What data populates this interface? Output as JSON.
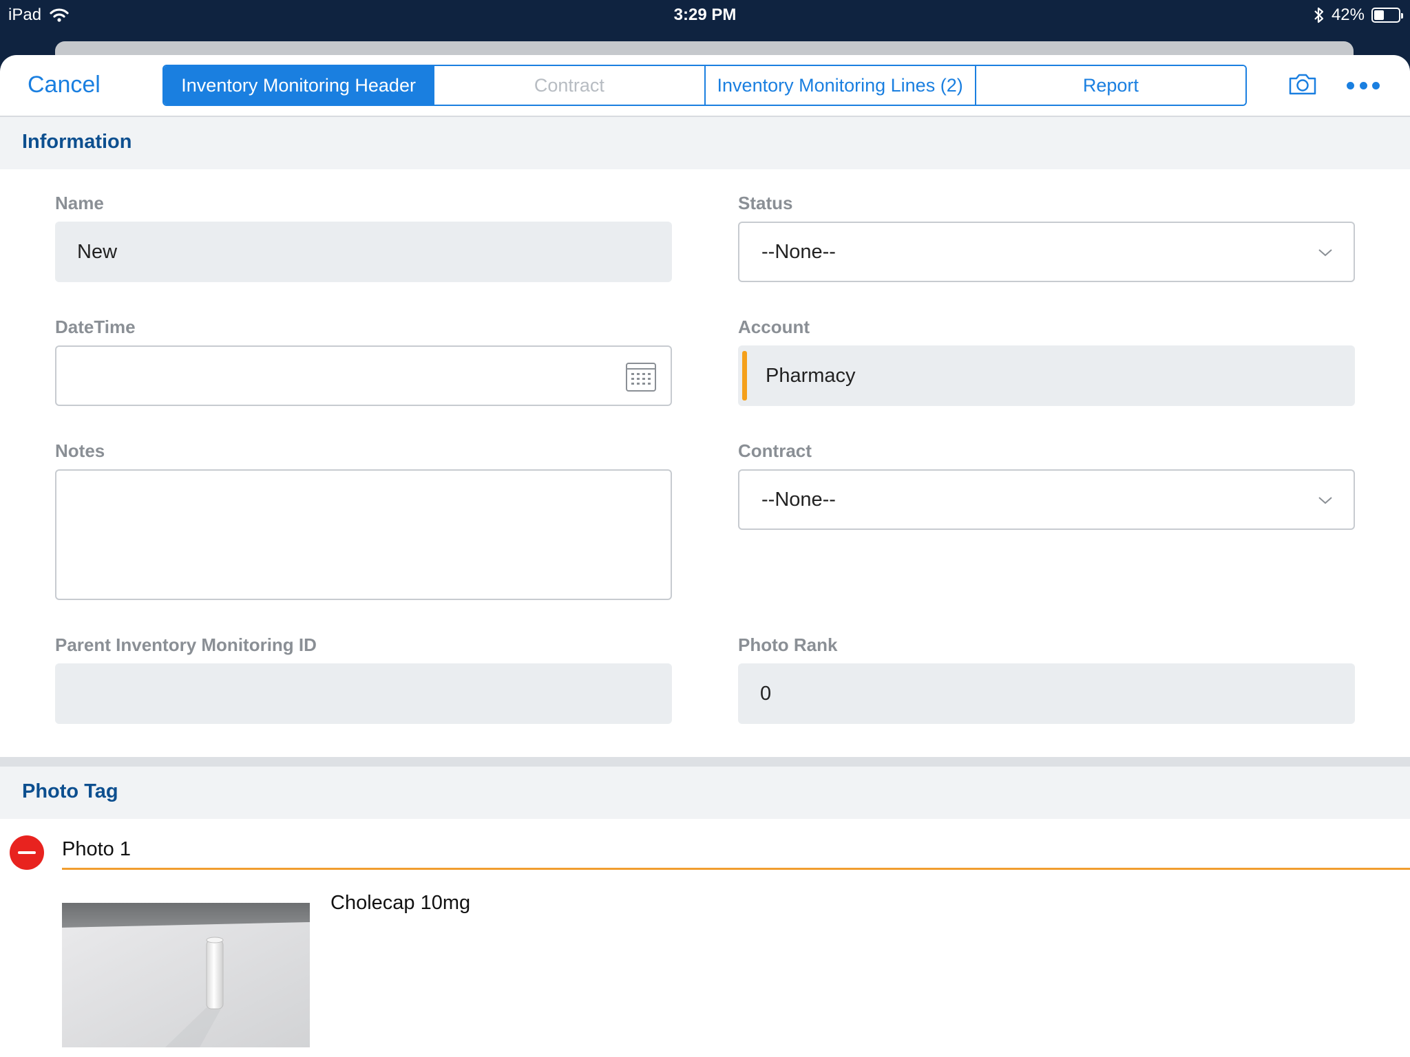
{
  "status_bar": {
    "device": "iPad",
    "time": "3:29 PM",
    "battery": "42%",
    "battery_level": 0.42
  },
  "nav": {
    "cancel_label": "Cancel",
    "segments": [
      {
        "label": "Inventory Monitoring Header",
        "state": "active"
      },
      {
        "label": "Contract",
        "state": "disabled"
      },
      {
        "label": "Inventory Monitoring Lines (2)",
        "state": "normal"
      },
      {
        "label": "Report",
        "state": "normal"
      }
    ],
    "camera_icon": "camera-icon",
    "more_icon": "more-icon"
  },
  "information": {
    "title": "Information",
    "name": {
      "label": "Name",
      "value": "New"
    },
    "status": {
      "label": "Status",
      "value": "--None--"
    },
    "datetime": {
      "label": "DateTime",
      "value": ""
    },
    "account": {
      "label": "Account",
      "value": "Pharmacy"
    },
    "notes": {
      "label": "Notes",
      "value": ""
    },
    "contract": {
      "label": "Contract",
      "value": "--None--"
    },
    "parent_id": {
      "label": "Parent Inventory Monitoring ID",
      "value": ""
    },
    "photo_rank": {
      "label": "Photo Rank",
      "value": "0"
    }
  },
  "photo_tag": {
    "title": "Photo Tag",
    "photo_label": "Photo 1",
    "caption": "Cholecap 10mg"
  },
  "colors": {
    "accent": "#1a7fe0",
    "section_title": "#0d4f8f",
    "required_bar": "#f5a01a",
    "delete": "#e8231f"
  }
}
